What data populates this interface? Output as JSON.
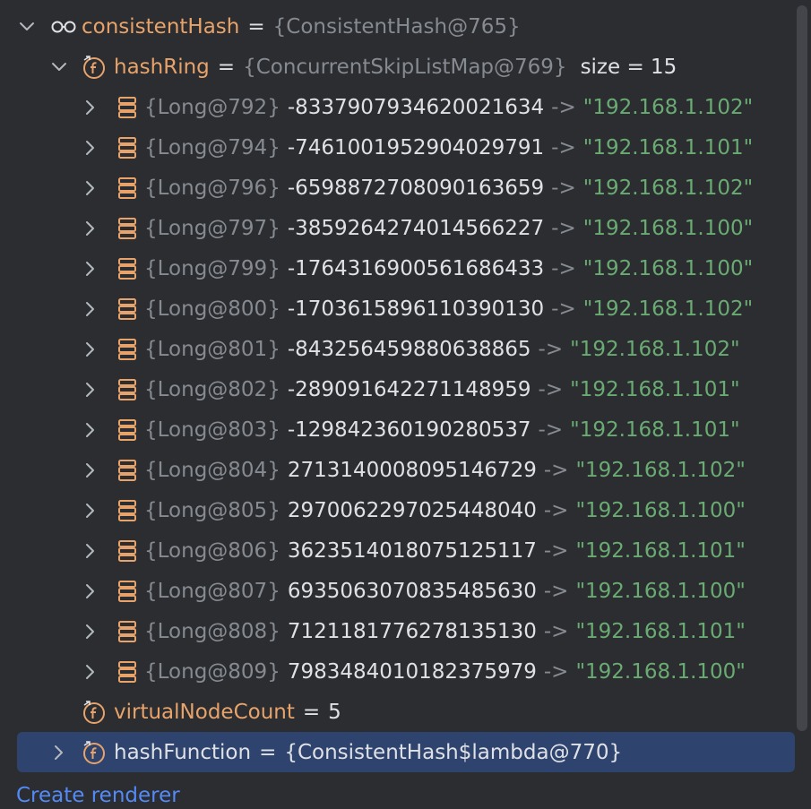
{
  "root": {
    "name": "consistentHash",
    "eq": "=",
    "type": "{ConsistentHash@765}"
  },
  "hashRing": {
    "name": "hashRing",
    "eq": "=",
    "type": "{ConcurrentSkipListMap@769}",
    "size_label": "size = 15",
    "entries": [
      {
        "type": "{Long@792}",
        "key": "-8337907934620021634",
        "arrow": "->",
        "value": "\"192.168.1.102\""
      },
      {
        "type": "{Long@794}",
        "key": "-7461001952904029791",
        "arrow": "->",
        "value": "\"192.168.1.101\""
      },
      {
        "type": "{Long@796}",
        "key": "-6598872708090163659",
        "arrow": "->",
        "value": "\"192.168.1.102\""
      },
      {
        "type": "{Long@797}",
        "key": "-3859264274014566227",
        "arrow": "->",
        "value": "\"192.168.1.100\""
      },
      {
        "type": "{Long@799}",
        "key": "-1764316900561686433",
        "arrow": "->",
        "value": "\"192.168.1.100\""
      },
      {
        "type": "{Long@800}",
        "key": "-1703615896110390130",
        "arrow": "->",
        "value": "\"192.168.1.102\""
      },
      {
        "type": "{Long@801}",
        "key": "-843256459880638865",
        "arrow": "->",
        "value": "\"192.168.1.102\""
      },
      {
        "type": "{Long@802}",
        "key": "-289091642271148959",
        "arrow": "->",
        "value": "\"192.168.1.101\""
      },
      {
        "type": "{Long@803}",
        "key": "-129842360190280537",
        "arrow": "->",
        "value": "\"192.168.1.101\""
      },
      {
        "type": "{Long@804}",
        "key": "2713140008095146729",
        "arrow": "->",
        "value": "\"192.168.1.102\""
      },
      {
        "type": "{Long@805}",
        "key": "2970062297025448040",
        "arrow": "->",
        "value": "\"192.168.1.100\""
      },
      {
        "type": "{Long@806}",
        "key": "3623514018075125117",
        "arrow": "->",
        "value": "\"192.168.1.101\""
      },
      {
        "type": "{Long@807}",
        "key": "6935063070835485630",
        "arrow": "->",
        "value": "\"192.168.1.100\""
      },
      {
        "type": "{Long@808}",
        "key": "7121181776278135130",
        "arrow": "->",
        "value": "\"192.168.1.101\""
      },
      {
        "type": "{Long@809}",
        "key": "7983484010182375979",
        "arrow": "->",
        "value": "\"192.168.1.100\""
      }
    ]
  },
  "virtualNodeCount": {
    "name": "virtualNodeCount",
    "eq": "=",
    "value": "5"
  },
  "hashFunction": {
    "name": "hashFunction",
    "eq": "=",
    "value": "{ConsistentHash$lambda@770}"
  },
  "footer": {
    "link_label": "Create renderer"
  },
  "colors": {
    "background": "#2b2d30",
    "selection": "#2e436e",
    "field_name": "#e8a36b",
    "type_gray": "#868a91",
    "string_green": "#6aab73",
    "link_blue": "#548af7",
    "icon_orange": "#e8a36b"
  },
  "icons": {
    "root": "watch-glasses-icon",
    "field": "field-f-icon",
    "entry": "map-entry-icon",
    "chevron_down": "chevron-down-icon",
    "chevron_right": "chevron-right-icon"
  }
}
